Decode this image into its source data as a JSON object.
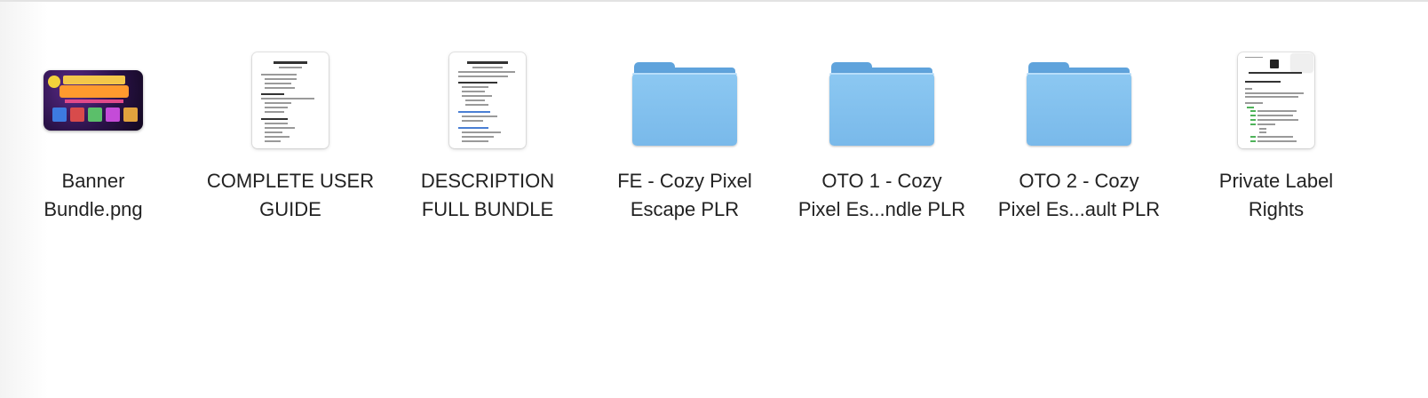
{
  "window": {
    "items": [
      {
        "kind": "image",
        "icon": "image-file-icon",
        "label_line1": "Banner",
        "label_line2": "Bundle.png"
      },
      {
        "kind": "document",
        "icon": "document-icon",
        "label_line1": "COMPLETE USER",
        "label_line2": "GUIDE"
      },
      {
        "kind": "document",
        "icon": "document-icon",
        "label_line1": "DESCRIPTION",
        "label_line2": "FULL BUNDLE"
      },
      {
        "kind": "folder",
        "icon": "folder-icon",
        "label_line1": "FE - Cozy Pixel",
        "label_line2": "Escape PLR"
      },
      {
        "kind": "folder",
        "icon": "folder-icon",
        "label_line1": "OTO 1 - Cozy",
        "label_line2": "Pixel Es...ndle PLR"
      },
      {
        "kind": "folder",
        "icon": "folder-icon",
        "label_line1": "OTO 2 - Cozy",
        "label_line2": "Pixel Es...ault PLR"
      },
      {
        "kind": "document",
        "icon": "document-icon",
        "label_line1": "Private Label",
        "label_line2": "Rights"
      }
    ]
  },
  "colors": {
    "folder": "#79b9ea",
    "label_text": "#222222",
    "background": "#ffffff"
  }
}
